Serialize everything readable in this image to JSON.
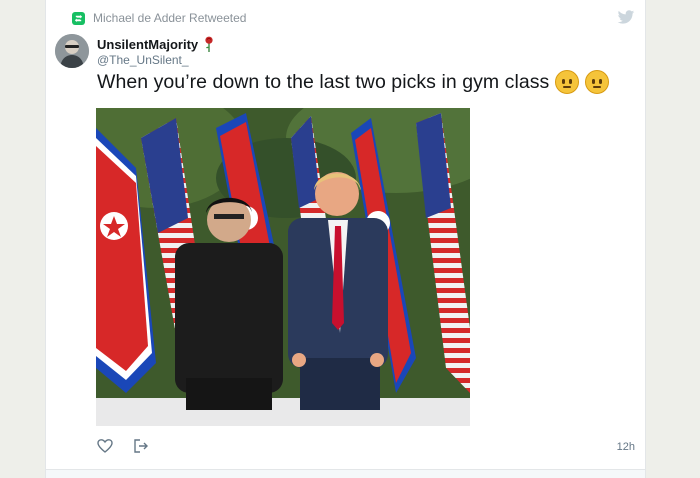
{
  "retweet": {
    "text": "Michael de Adder Retweeted"
  },
  "author": {
    "display_name": "UnsilentMajority",
    "handle": "@The_UnSilent_"
  },
  "tweet": {
    "text": "When you’re down to the last two picks in gym class"
  },
  "meta": {
    "timestamp": "12h"
  },
  "icons": {
    "retweet": "retweet-icon",
    "bird": "twitter-bird-icon",
    "rose": "rose-emoji",
    "emoji": "neutral-face-emoji",
    "like": "heart-icon",
    "share": "share-icon"
  },
  "colors": {
    "retweet": "#17bf63",
    "bird": "#ccd6dd",
    "text": "#14171a",
    "muted": "#657786"
  }
}
